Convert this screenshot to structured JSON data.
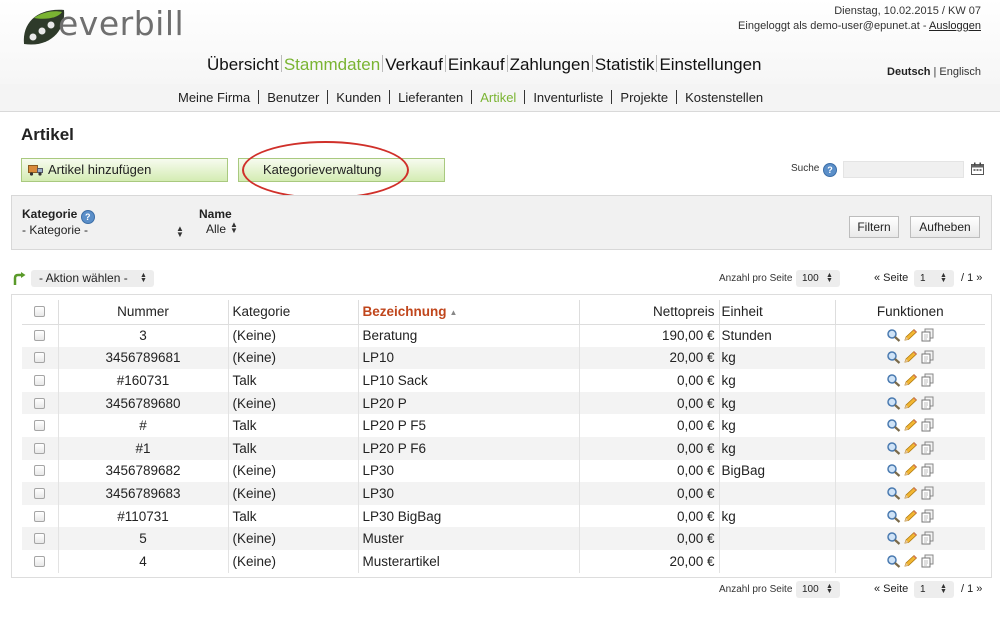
{
  "header": {
    "brand": "everbill",
    "date_line": "Dienstag, 10.02.2015 / KW 07",
    "logged_in_prefix": "Eingeloggt als demo-user@epunet.at -",
    "logout": "Ausloggen",
    "lang_active": "Deutsch",
    "lang_sep": "|",
    "lang_other": "Englisch"
  },
  "main_nav": [
    "Übersicht",
    "Stammdaten",
    "Verkauf",
    "Einkauf",
    "Zahlungen",
    "Statistik",
    "Einstellungen"
  ],
  "main_nav_active": "Stammdaten",
  "sub_nav": [
    "Meine Firma",
    "Benutzer",
    "Kunden",
    "Lieferanten",
    "Artikel",
    "Inventurliste",
    "Projekte",
    "Kostenstellen"
  ],
  "sub_nav_active": "Artikel",
  "page": {
    "title": "Artikel",
    "add_button": "Artikel hinzufügen",
    "category_button": "Kategorieverwaltung",
    "search_label": "Suche",
    "search_value": ""
  },
  "filter": {
    "category_label": "Kategorie",
    "category_value": "- Kategorie -",
    "name_label": "Name",
    "name_value": "Alle",
    "filter_button": "Filtern",
    "reset_button": "Aufheben"
  },
  "actions": {
    "action_select": "- Aktion wählen -",
    "per_page_label": "Anzahl pro Seite",
    "per_page_value": "100",
    "page_prefix": "« Seite",
    "page_value": "1",
    "page_suffix": "/ 1 »"
  },
  "table": {
    "columns": [
      "Nummer",
      "Kategorie",
      "Bezeichnung",
      "Nettopreis",
      "Einheit",
      "Funktionen"
    ],
    "sorted_column": "Bezeichnung",
    "rows": [
      {
        "nummer": "3",
        "kategorie": "(Keine)",
        "bezeichnung": "Beratung",
        "preis": "190,00 €",
        "einheit": "Stunden"
      },
      {
        "nummer": "3456789681",
        "kategorie": "(Keine)",
        "bezeichnung": "LP10",
        "preis": "20,00 €",
        "einheit": "kg"
      },
      {
        "nummer": "#160731",
        "kategorie": "Talk",
        "bezeichnung": "LP10 Sack",
        "preis": "0,00 €",
        "einheit": "kg"
      },
      {
        "nummer": "3456789680",
        "kategorie": "(Keine)",
        "bezeichnung": "LP20 P",
        "preis": "0,00 €",
        "einheit": "kg"
      },
      {
        "nummer": "#",
        "kategorie": "Talk",
        "bezeichnung": "LP20 P F5",
        "preis": "0,00 €",
        "einheit": "kg"
      },
      {
        "nummer": "#1",
        "kategorie": "Talk",
        "bezeichnung": "LP20 P F6",
        "preis": "0,00 €",
        "einheit": "kg"
      },
      {
        "nummer": "3456789682",
        "kategorie": "(Keine)",
        "bezeichnung": "LP30",
        "preis": "0,00 €",
        "einheit": "BigBag"
      },
      {
        "nummer": "3456789683",
        "kategorie": "(Keine)",
        "bezeichnung": "LP30",
        "preis": "0,00 €",
        "einheit": ""
      },
      {
        "nummer": "#110731",
        "kategorie": "Talk",
        "bezeichnung": "LP30 BigBag",
        "preis": "0,00 €",
        "einheit": "kg"
      },
      {
        "nummer": "5",
        "kategorie": "(Keine)",
        "bezeichnung": "Muster",
        "preis": "0,00 €",
        "einheit": ""
      },
      {
        "nummer": "4",
        "kategorie": "(Keine)",
        "bezeichnung": "Musterartikel",
        "preis": "20,00 €",
        "einheit": ""
      }
    ]
  },
  "colors": {
    "accent_green": "#7ab432",
    "sort_orange": "#c0461c",
    "highlight_red": "#d0302a"
  },
  "icons": {
    "row_functions": [
      "magnifier-icon",
      "pencil-icon",
      "copy-icon"
    ]
  }
}
